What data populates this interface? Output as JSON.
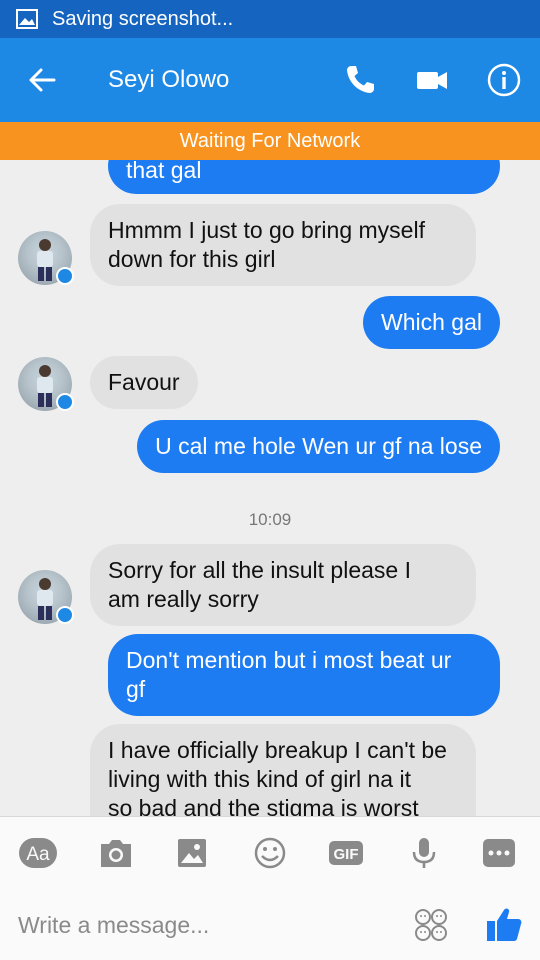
{
  "status_bar": {
    "text": "Saving screenshot..."
  },
  "header": {
    "contact_name": "Seyi Olowo"
  },
  "banner": {
    "text": "Waiting For Network"
  },
  "messages": {
    "m0": "that gal",
    "m1_line1": "Hmmm I just to go bring myself",
    "m1_line2": "down for this girl",
    "m2": "Which gal",
    "m3": "Favour",
    "m4": "U cal me hole Wen ur gf na lose",
    "timestamp": "10:09",
    "m5_line1": "Sorry for all the insult please I",
    "m5_line2": "am really sorry",
    "m6_line1": "Don't mention but i most beat ur",
    "m6_line2": "gf",
    "m7_line1": "I have officially breakup I can't be",
    "m7_line2": "living with this kind of girl na it",
    "m7_line3": "so bad and the stigma is worst"
  },
  "toolbar": {
    "aa_label": "Aa",
    "gif_label": "GIF"
  },
  "compose": {
    "placeholder": "Write a message..."
  },
  "colors": {
    "status_bar": "#1565c0",
    "app_bar": "#1e88e5",
    "banner": "#f7931e",
    "outgoing_bubble": "#1e7cf2",
    "incoming_bubble": "#e1e1e1"
  }
}
